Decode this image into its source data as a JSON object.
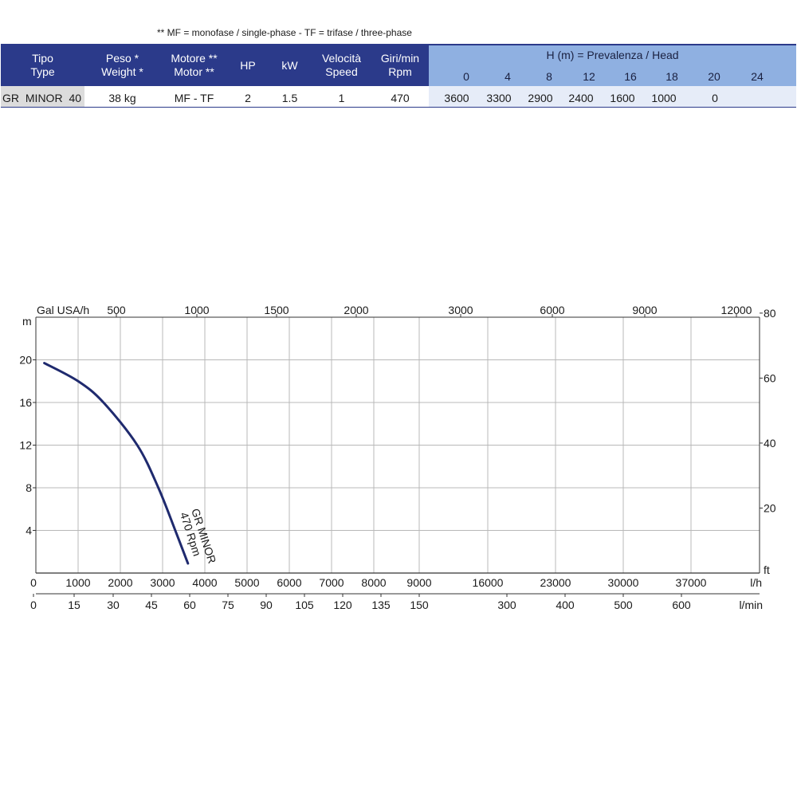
{
  "note": "** MF = monofase / single-phase - TF = trifase / three-phase",
  "table": {
    "columns": [
      {
        "l1": "Tipo",
        "l2": "Type"
      },
      {
        "l1": "Peso *",
        "l2": "Weight *"
      },
      {
        "l1": "Motore **",
        "l2": "Motor **"
      },
      {
        "l1": "HP",
        "l2": ""
      },
      {
        "l1": "kW",
        "l2": ""
      },
      {
        "l1": "Velocità",
        "l2": "Speed"
      },
      {
        "l1": "Giri/min",
        "l2": "Rpm"
      }
    ],
    "head_title": "H (m) = Prevalenza / Head",
    "head_values": [
      "0",
      "4",
      "8",
      "12",
      "16",
      "18",
      "20",
      "24"
    ],
    "row": {
      "type": "GR MINOR 40",
      "weight": "38 kg",
      "motor": "MF - TF",
      "hp": "2",
      "kw": "1.5",
      "speed": "1",
      "rpm": "470",
      "flows": [
        "3600",
        "3300",
        "2900",
        "2400",
        "1600",
        "1000",
        "0",
        ""
      ]
    }
  },
  "chart_data": {
    "type": "line",
    "left_axis_label": "m",
    "left_ticks": [
      "4",
      "8",
      "12",
      "16",
      "20"
    ],
    "right_axis_label": "ft",
    "right_ticks": [
      "20",
      "40",
      "60",
      "80"
    ],
    "top_axis_label": "Gal USA/h",
    "top_ticks": [
      "500",
      "1000",
      "1500",
      "2000",
      "3000",
      "6000",
      "9000",
      "12000"
    ],
    "bottom_axis_label": "l/h",
    "bottom_ticks": [
      "0",
      "1000",
      "2000",
      "3000",
      "4000",
      "5000",
      "6000",
      "7000",
      "8000",
      "9000",
      "16000",
      "23000",
      "30000",
      "37000"
    ],
    "bottom2_axis_label": "l/min",
    "bottom2_ticks": [
      "0",
      "15",
      "30",
      "45",
      "60",
      "75",
      "90",
      "105",
      "120",
      "135",
      "150",
      "300",
      "400",
      "500",
      "600"
    ],
    "grid": true,
    "series": [
      {
        "name": "GR MINOR",
        "label_lines": [
          "GR MINOR",
          "470 Rpm"
        ],
        "color": "#1f2a6e",
        "x_lh": [
          200,
          1000,
          1600,
          2400,
          2900,
          3300,
          3600
        ],
        "y_m": [
          19.7,
          18.0,
          16.0,
          12.0,
          8.0,
          4.0,
          0.9
        ]
      }
    ]
  }
}
